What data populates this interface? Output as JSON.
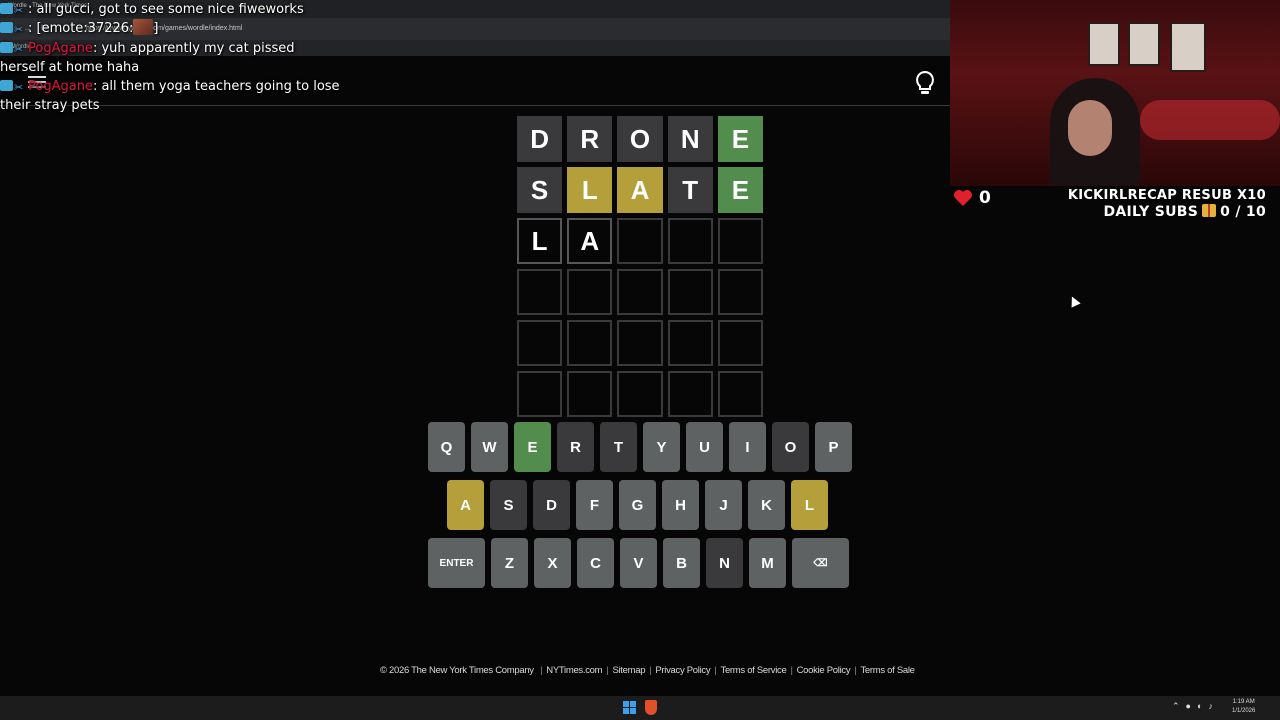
{
  "browser": {
    "tab_title": "Wordle - The New York Times",
    "url": "https://www.nytimes.com/games/wordle/index.html",
    "bookmark": "Wordle"
  },
  "board": {
    "rows": [
      [
        {
          "l": "D",
          "s": "absent"
        },
        {
          "l": "R",
          "s": "absent"
        },
        {
          "l": "O",
          "s": "absent"
        },
        {
          "l": "N",
          "s": "absent"
        },
        {
          "l": "E",
          "s": "correct"
        }
      ],
      [
        {
          "l": "S",
          "s": "absent"
        },
        {
          "l": "L",
          "s": "present"
        },
        {
          "l": "A",
          "s": "present"
        },
        {
          "l": "T",
          "s": "absent"
        },
        {
          "l": "E",
          "s": "correct"
        }
      ],
      [
        {
          "l": "L",
          "s": "tbd"
        },
        {
          "l": "A",
          "s": "tbd"
        },
        {
          "l": "",
          "s": "empty"
        },
        {
          "l": "",
          "s": "empty"
        },
        {
          "l": "",
          "s": "empty"
        }
      ],
      [
        {
          "l": "",
          "s": "empty"
        },
        {
          "l": "",
          "s": "empty"
        },
        {
          "l": "",
          "s": "empty"
        },
        {
          "l": "",
          "s": "empty"
        },
        {
          "l": "",
          "s": "empty"
        }
      ],
      [
        {
          "l": "",
          "s": "empty"
        },
        {
          "l": "",
          "s": "empty"
        },
        {
          "l": "",
          "s": "empty"
        },
        {
          "l": "",
          "s": "empty"
        },
        {
          "l": "",
          "s": "empty"
        }
      ],
      [
        {
          "l": "",
          "s": "empty"
        },
        {
          "l": "",
          "s": "empty"
        },
        {
          "l": "",
          "s": "empty"
        },
        {
          "l": "",
          "s": "empty"
        },
        {
          "l": "",
          "s": "empty"
        }
      ]
    ]
  },
  "keyboard": {
    "rows": [
      [
        {
          "k": "Q",
          "s": "unused"
        },
        {
          "k": "W",
          "s": "unused"
        },
        {
          "k": "E",
          "s": "correct"
        },
        {
          "k": "R",
          "s": "absent"
        },
        {
          "k": "T",
          "s": "absent"
        },
        {
          "k": "Y",
          "s": "unused"
        },
        {
          "k": "U",
          "s": "unused"
        },
        {
          "k": "I",
          "s": "unused"
        },
        {
          "k": "O",
          "s": "absent"
        },
        {
          "k": "P",
          "s": "unused"
        }
      ],
      [
        {
          "k": "A",
          "s": "present"
        },
        {
          "k": "S",
          "s": "absent"
        },
        {
          "k": "D",
          "s": "absent"
        },
        {
          "k": "F",
          "s": "unused"
        },
        {
          "k": "G",
          "s": "unused"
        },
        {
          "k": "H",
          "s": "unused"
        },
        {
          "k": "J",
          "s": "unused"
        },
        {
          "k": "K",
          "s": "unused"
        },
        {
          "k": "L",
          "s": "present"
        }
      ],
      [
        {
          "k": "ENTER",
          "s": "unused",
          "wide": true
        },
        {
          "k": "Z",
          "s": "unused"
        },
        {
          "k": "X",
          "s": "unused"
        },
        {
          "k": "C",
          "s": "unused"
        },
        {
          "k": "V",
          "s": "unused"
        },
        {
          "k": "B",
          "s": "unused"
        },
        {
          "k": "N",
          "s": "absent"
        },
        {
          "k": "M",
          "s": "unused"
        },
        {
          "k": "⌫",
          "s": "unused",
          "wide": true
        }
      ]
    ]
  },
  "footer": {
    "copyright": "© 2026 The New York Times Company",
    "links": [
      "NYTimes.com",
      "Sitemap",
      "Privacy Policy",
      "Terms of Service",
      "Cookie Policy",
      "Terms of Sale"
    ]
  },
  "chat": {
    "messages": [
      {
        "user": "",
        "text": ": all gucci, got to see some nice fiweworks"
      },
      {
        "user": "",
        "text": ": [emote:37226:",
        "emote_end": "]"
      },
      {
        "user": "PogAgane",
        "text": ": yuh apparently my cat pissed herself at home haha"
      },
      {
        "user": "PogAgane",
        "text": ": all them yoga teachers going to lose their stray pets"
      }
    ]
  },
  "overlay": {
    "likes_count": "0",
    "resub_line": "KICKIRLRECAP RESUB X10",
    "daily_subs_label": "DAILY SUBS",
    "daily_subs_value": "0 / 10"
  },
  "taskbar": {
    "time": "1:19 AM",
    "date": "1/1/2026"
  },
  "colors": {
    "correct": "#538d4e",
    "present": "#b59f3b",
    "absent": "#3a3a3c",
    "unused_key": "#818384",
    "chat_user": "#e0143c"
  }
}
